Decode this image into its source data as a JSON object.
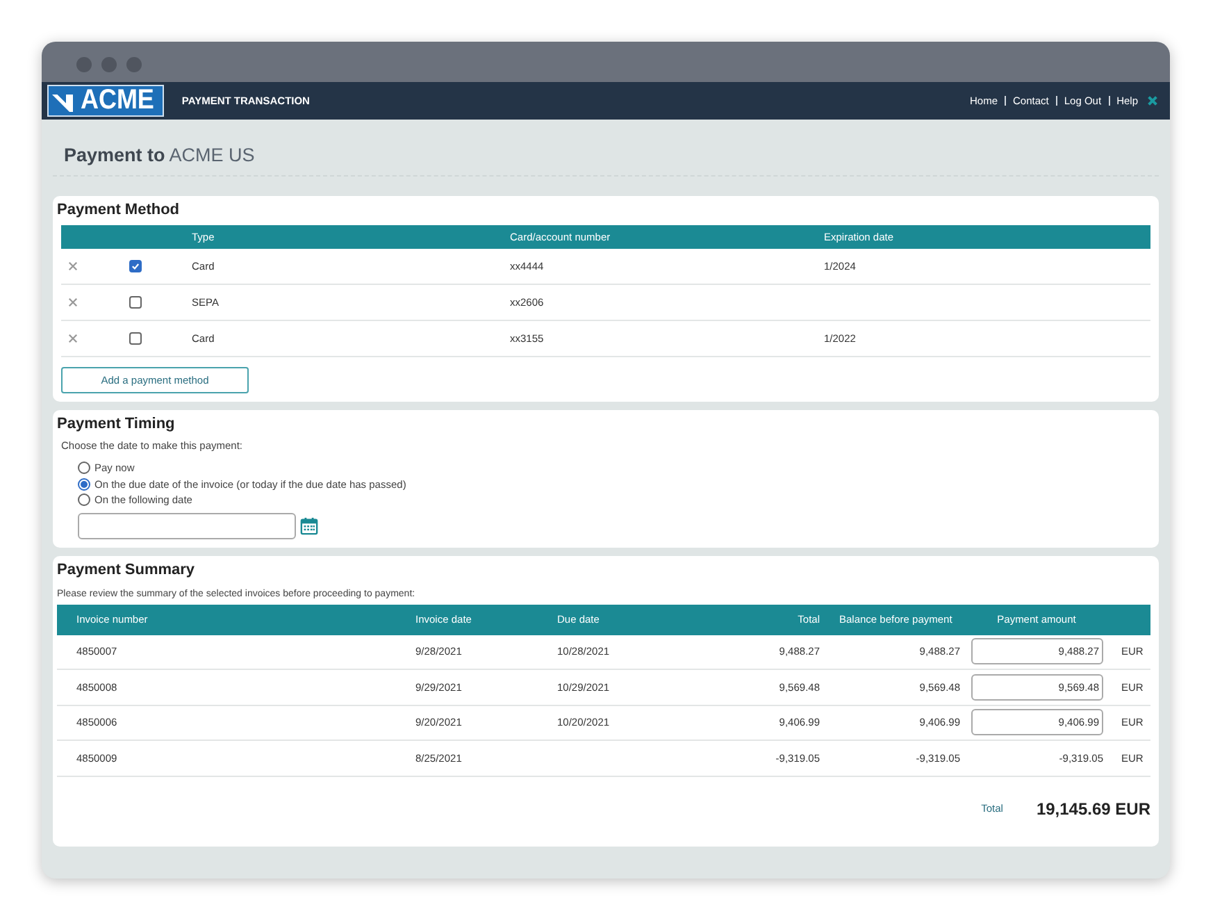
{
  "header": {
    "logo": "ACME",
    "title": "PAYMENT TRANSACTION",
    "links": [
      "Home",
      "Contact",
      "Log Out",
      "Help"
    ]
  },
  "page_title": {
    "lead": "Payment to",
    "name": "ACME US"
  },
  "payment_method": {
    "title": "Payment Method",
    "columns": [
      "Type",
      "Card/account number",
      "Expiration date"
    ],
    "rows": [
      {
        "checked": true,
        "type": "Card",
        "number": "xx4444",
        "expiration": "1/2024"
      },
      {
        "checked": false,
        "type": "SEPA",
        "number": "xx2606",
        "expiration": ""
      },
      {
        "checked": false,
        "type": "Card",
        "number": "xx3155",
        "expiration": "1/2022"
      }
    ],
    "add_button": "Add a payment method"
  },
  "payment_timing": {
    "title": "Payment Timing",
    "prompt": "Choose the date to make this payment:",
    "options": [
      {
        "label": "Pay now",
        "selected": false
      },
      {
        "label": "On the due date of the invoice (or today if the due date has passed)",
        "selected": true
      },
      {
        "label": "On the following date",
        "selected": false
      }
    ]
  },
  "payment_summary": {
    "title": "Payment Summary",
    "intro": "Please review the summary of the selected invoices before proceeding to payment:",
    "columns": [
      "Invoice number",
      "Invoice date",
      "Due date",
      "Total",
      "Balance before payment",
      "Payment amount"
    ],
    "rows": [
      {
        "invoice": "4850007",
        "invoice_date": "9/28/2021",
        "due_date": "10/28/2021",
        "total": "9,488.27",
        "balance": "9,488.27",
        "amount": {
          "kind": "input",
          "value": "9,488.27"
        },
        "currency": "EUR"
      },
      {
        "invoice": "4850008",
        "invoice_date": "9/29/2021",
        "due_date": "10/29/2021",
        "total": "9,569.48",
        "balance": "9,569.48",
        "amount": {
          "kind": "input",
          "value": "9,569.48"
        },
        "currency": "EUR"
      },
      {
        "invoice": "4850006",
        "invoice_date": "9/20/2021",
        "due_date": "10/20/2021",
        "total": "9,406.99",
        "balance": "9,406.99",
        "amount": {
          "kind": "input",
          "value": "9,406.99"
        },
        "currency": "EUR"
      },
      {
        "invoice": "4850009",
        "invoice_date": "8/25/2021",
        "due_date": "",
        "total": "-9,319.05",
        "balance": "-9,319.05",
        "amount": {
          "kind": "text",
          "value": "-9,319.05"
        },
        "currency": "EUR"
      }
    ],
    "total_label": "Total",
    "total_value": "19,145.69 EUR"
  }
}
